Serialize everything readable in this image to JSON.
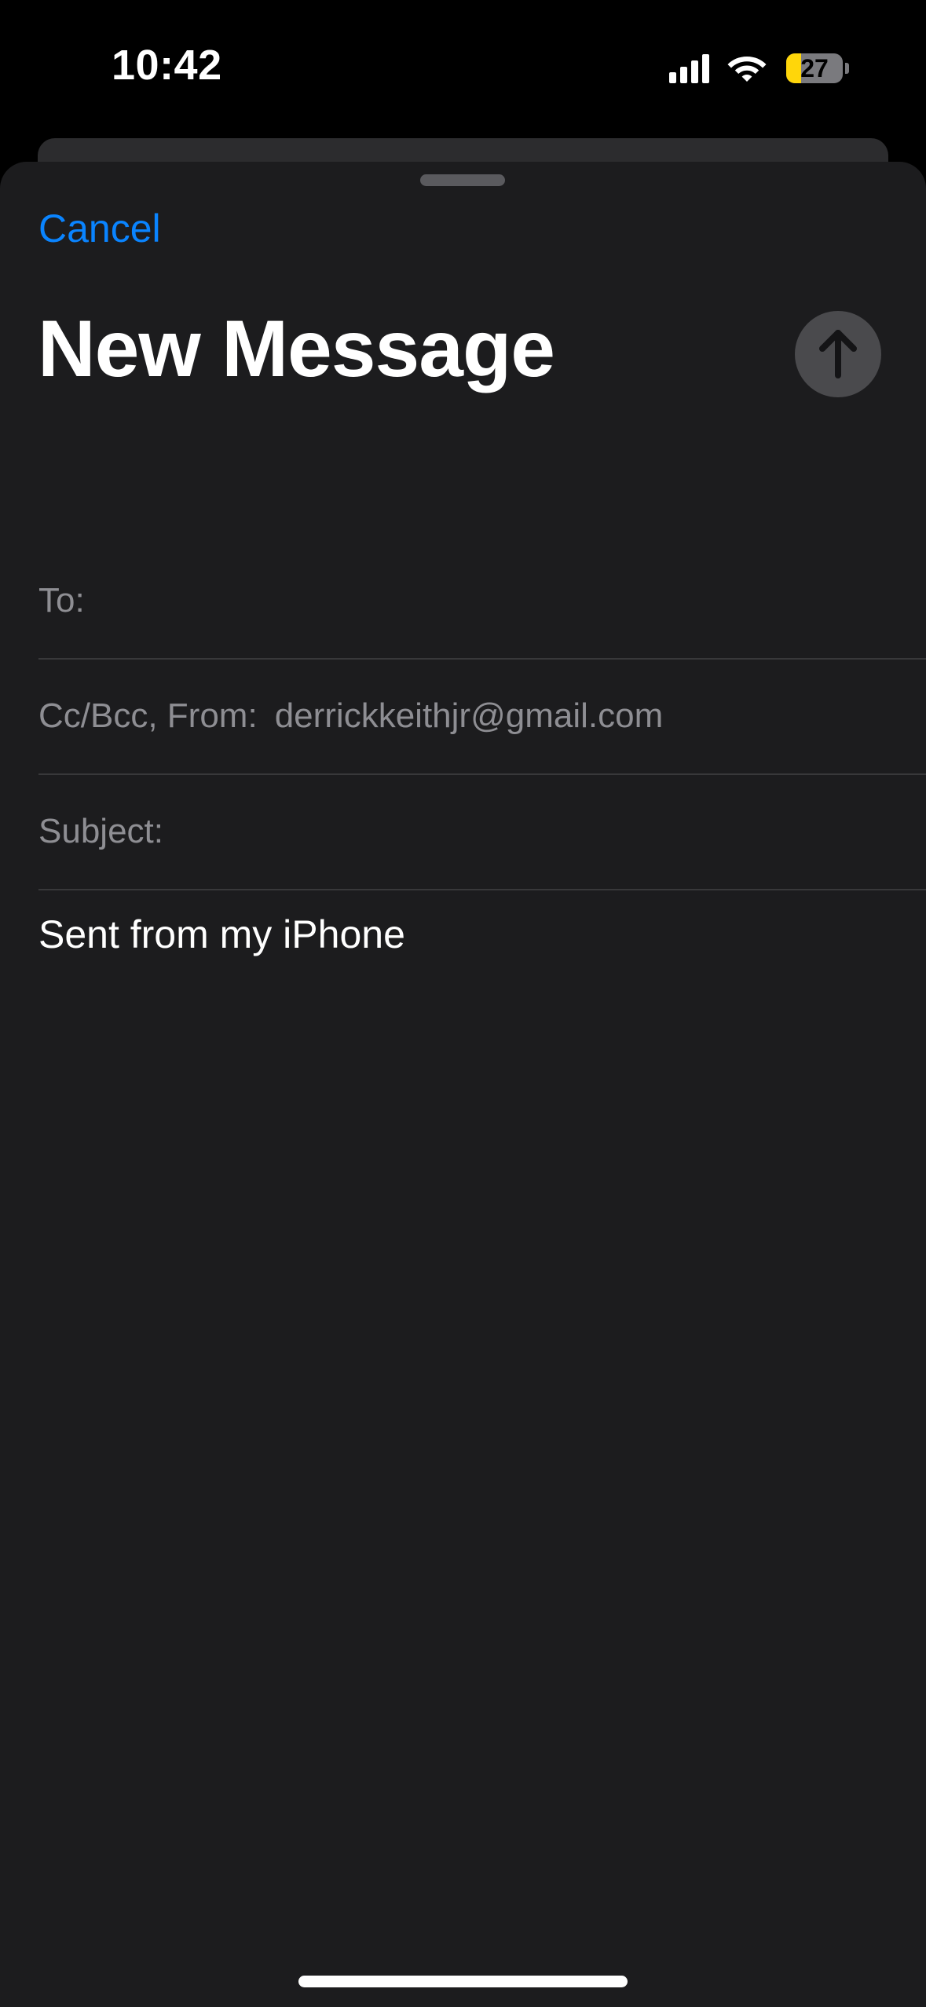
{
  "status_bar": {
    "time": "10:42",
    "battery_level": "27",
    "battery_fraction": 0.27,
    "icons": [
      "cellular-signal-icon",
      "wifi-icon",
      "battery-icon"
    ]
  },
  "compose": {
    "cancel_label": "Cancel",
    "title": "New Message",
    "send_icon": "arrow-up-icon",
    "to_label": "To:",
    "to_value": "",
    "ccbcc_label": "Cc/Bcc, From:",
    "from_value": "derrickkeithjr@gmail.com",
    "subject_label": "Subject:",
    "subject_value": "",
    "signature": "Sent from my iPhone"
  },
  "colors": {
    "accent": "#0a84ff",
    "sheet_background": "#1c1c1e",
    "secondary_text": "#8e8e93",
    "battery_low": "#ffd60a"
  }
}
